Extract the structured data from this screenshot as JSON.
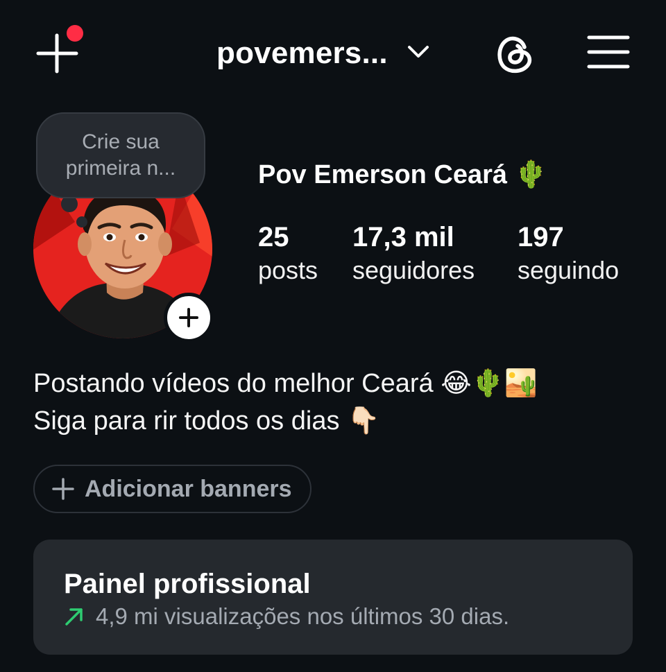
{
  "header": {
    "username": "povemers...",
    "icons": {
      "create": "plus-icon",
      "dropdown": "chevron-down-icon",
      "threads": "threads-icon",
      "menu": "hamburger-menu-icon"
    }
  },
  "note": {
    "text": "Crie sua primeira n..."
  },
  "profile": {
    "display_name": "Pov Emerson Ceará 🌵",
    "stats": [
      {
        "value": "25",
        "label": "posts"
      },
      {
        "value": "17,3 mil",
        "label": "seguidores"
      },
      {
        "value": "197",
        "label": "seguindo"
      }
    ],
    "bio_lines": [
      "Postando vídeos do melhor Ceará 😂🌵🏜️",
      "Siga para rir todos os dias 👇🏻"
    ]
  },
  "banners": {
    "label": "Adicionar banners"
  },
  "professional_panel": {
    "title": "Painel profissional",
    "subtitle": "4,9 mi visualizações nos últimos 30 dias."
  },
  "colors": {
    "background": "#0c1014",
    "notification_dot": "#ff2d45",
    "panel_bg": "#25292e",
    "trend_arrow": "#2ecc71",
    "avatar_bg": "#e5231f"
  }
}
